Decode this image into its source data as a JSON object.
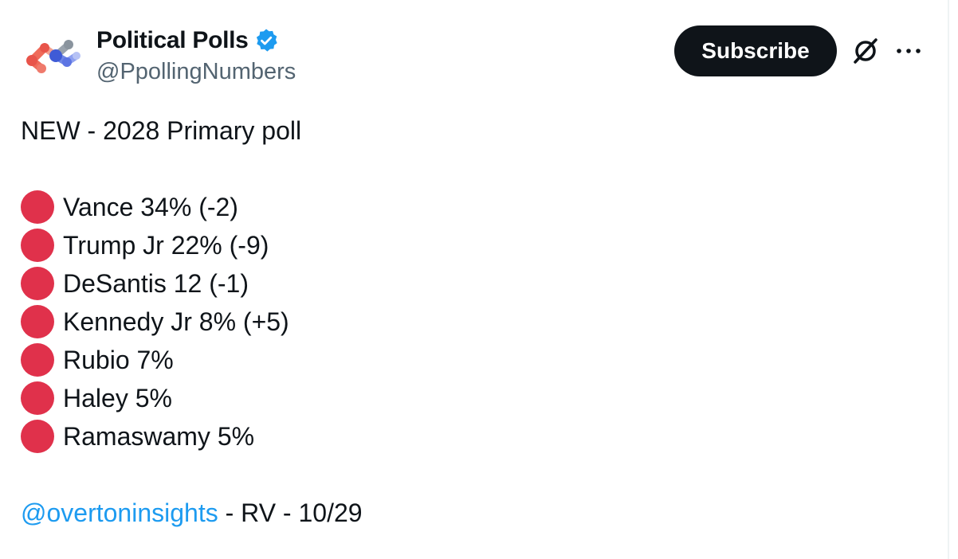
{
  "author": {
    "display_name": "Political Polls",
    "handle": "@PpollingNumbers",
    "verified": true
  },
  "actions": {
    "subscribe_label": "Subscribe",
    "grok_icon": "grok-icon",
    "more_icon": "more-icon"
  },
  "post": {
    "headline": "NEW - 2028 Primary poll",
    "candidates": [
      "Vance 34% (-2)",
      "Trump Jr 22% (-9)",
      "DeSantis 12 (-1)",
      "Kennedy Jr 8% (+5)",
      "Rubio 7%",
      "Haley 5%",
      "Ramaswamy 5%"
    ],
    "mention": "@overtoninsights",
    "source_suffix": " - RV - 10/29"
  },
  "colors": {
    "dot": "#e0314b",
    "link": "#1d9bf0",
    "verified": "#1d9bf0",
    "subscribe_bg": "#0f1419"
  }
}
